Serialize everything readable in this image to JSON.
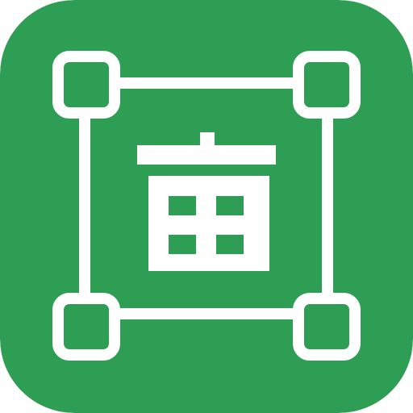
{
  "icon": {
    "name": "land-area-measure-app-icon",
    "glyph": "亩",
    "colors": {
      "background": "#2f9e55",
      "foreground": "#ffffff"
    }
  }
}
